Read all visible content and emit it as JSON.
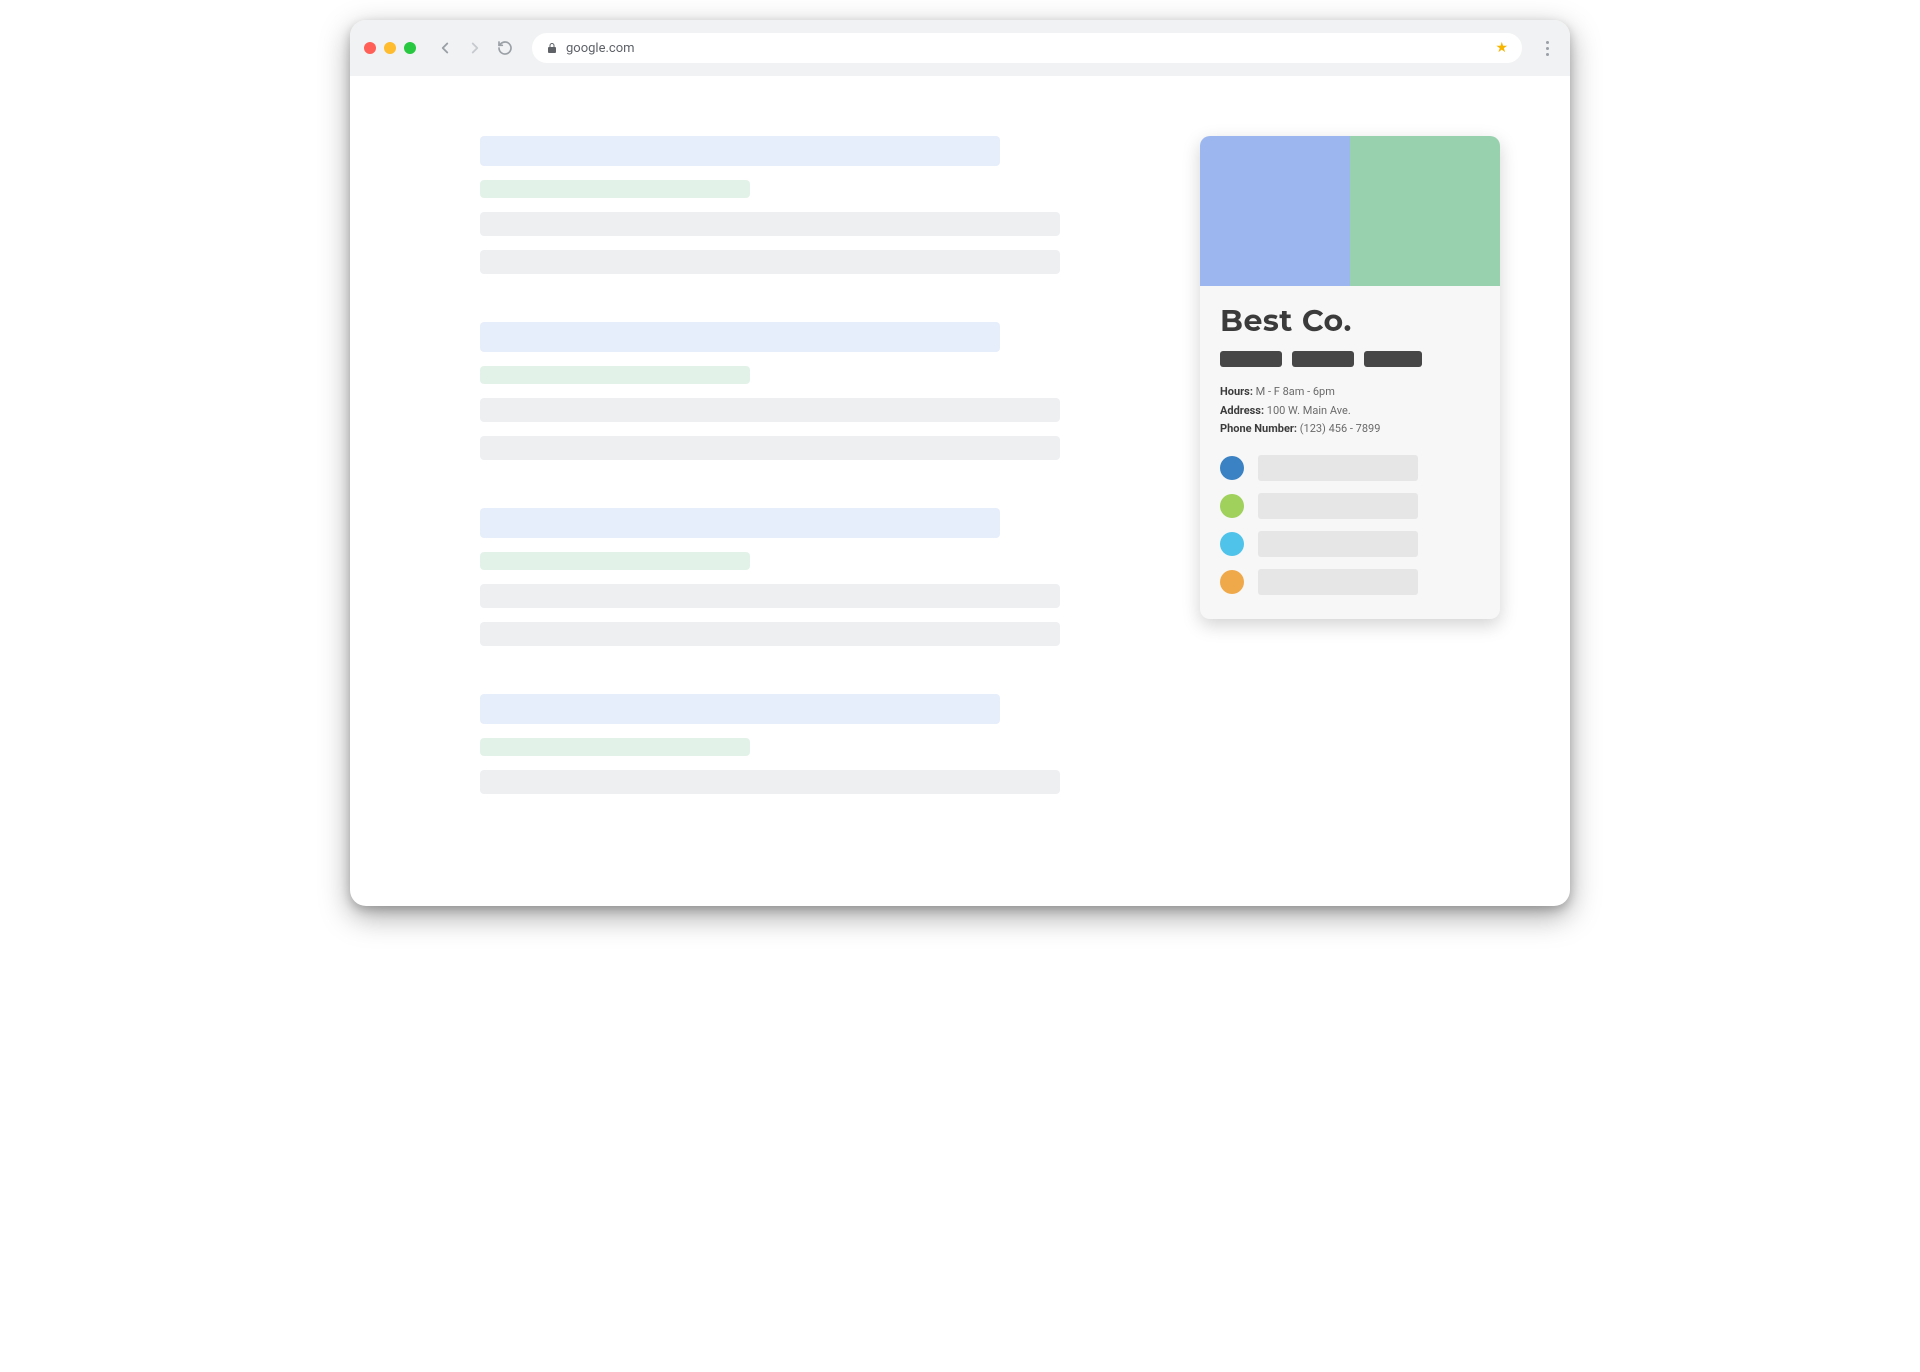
{
  "browser": {
    "url": "google.com",
    "bookmarked": true
  },
  "knowledge_panel": {
    "title": "Best Co.",
    "info": {
      "hours_label": "Hours:",
      "hours_value": "M - F 8am - 6pm",
      "address_label": "Address:",
      "address_value": "100 W. Main Ave.",
      "phone_label": "Phone Number:",
      "phone_value": "(123) 456 - 7899"
    },
    "profile_colors": [
      "#3b82c4",
      "#9fd15c",
      "#4fc3ea",
      "#f0a94a"
    ]
  }
}
